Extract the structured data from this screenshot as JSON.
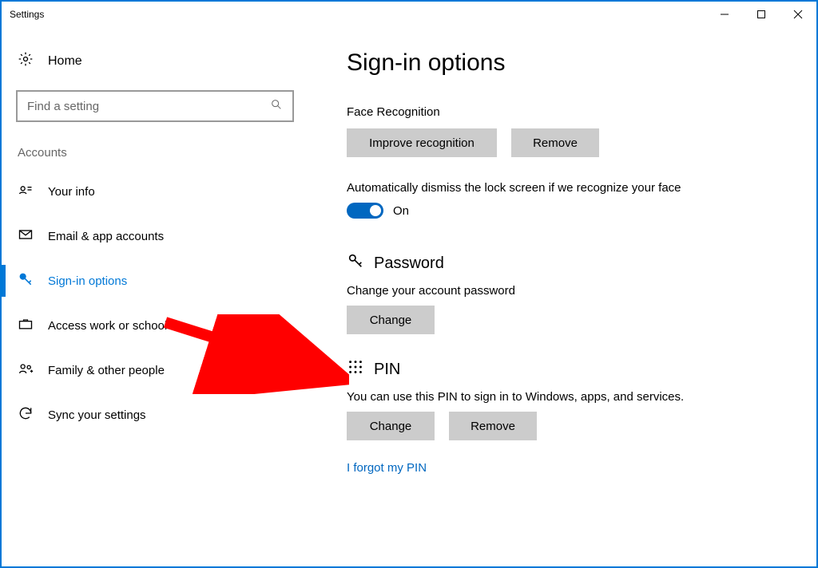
{
  "window": {
    "title": "Settings"
  },
  "sidebar": {
    "home_label": "Home",
    "search_placeholder": "Find a setting",
    "section_label": "Accounts",
    "items": [
      {
        "label": "Your info"
      },
      {
        "label": "Email & app accounts"
      },
      {
        "label": "Sign-in options"
      },
      {
        "label": "Access work or school"
      },
      {
        "label": "Family & other people"
      },
      {
        "label": "Sync your settings"
      }
    ]
  },
  "main": {
    "title": "Sign-in options",
    "face": {
      "heading": "Face Recognition",
      "improve_btn": "Improve recognition",
      "remove_btn": "Remove",
      "auto_dismiss_text": "Automatically dismiss the lock screen if we recognize your face",
      "toggle_state": "On"
    },
    "password": {
      "heading": "Password",
      "desc": "Change your account password",
      "change_btn": "Change"
    },
    "pin": {
      "heading": "PIN",
      "desc": "You can use this PIN to sign in to Windows, apps, and services.",
      "change_btn": "Change",
      "remove_btn": "Remove",
      "forgot_link": "I forgot my PIN"
    }
  }
}
